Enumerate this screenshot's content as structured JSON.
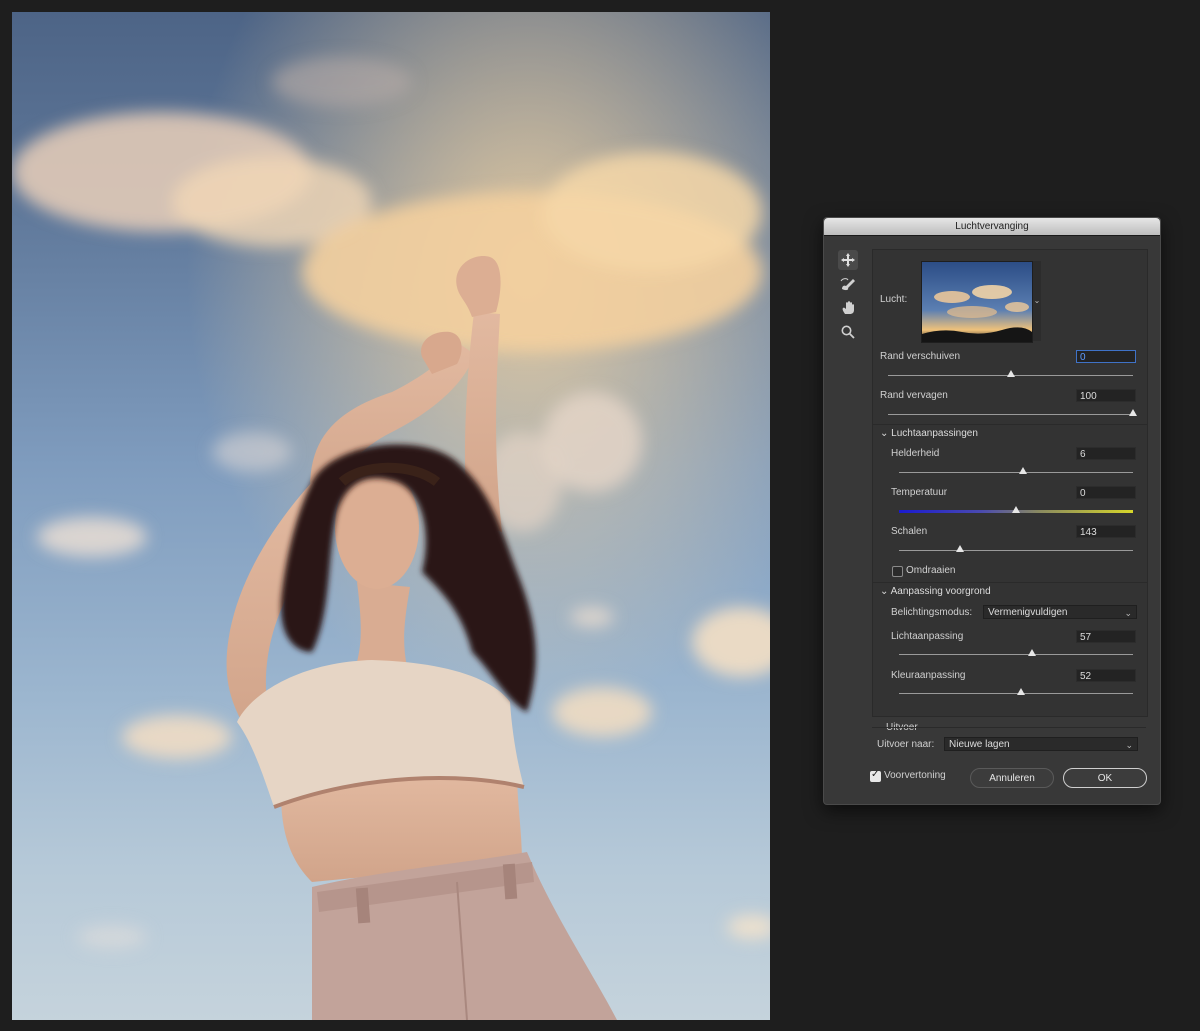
{
  "dialog": {
    "title": "Luchtvervanging",
    "sky_label": "Lucht:",
    "edge": {
      "shift_label": "Rand verschuiven",
      "shift_value": "0",
      "shift_level": 0.5,
      "fade_label": "Rand vervagen",
      "fade_value": "100",
      "fade_level": 1.0
    },
    "sky_adjust": {
      "header": "Luchtaanpassingen",
      "brightness_label": "Helderheid",
      "brightness_value": "6",
      "brightness_level": 0.53,
      "temperature_label": "Temperatuur",
      "temperature_value": "0",
      "temperature_level": 0.5,
      "scale_label": "Schalen",
      "scale_value": "143",
      "scale_level": 0.26,
      "flip_label": "Omdraaien"
    },
    "foreground": {
      "header": "Aanpassing voorgrond",
      "blend_label": "Belichtingsmodus:",
      "blend_value": "Vermenigvuldigen",
      "light_label": "Lichtaanpassing",
      "light_value": "57",
      "light_level": 0.57,
      "color_label": "Kleuraanpassing",
      "color_value": "52",
      "color_level": 0.52
    },
    "output": {
      "header": "Uitvoer",
      "to_label": "Uitvoer naar:",
      "to_value": "Nieuwe lagen"
    },
    "preview_label": "Voorvertoning",
    "cancel_label": "Annuleren",
    "ok_label": "OK"
  },
  "tools": [
    "move-sky-icon",
    "sky-brush-icon",
    "hand-icon",
    "zoom-icon"
  ]
}
